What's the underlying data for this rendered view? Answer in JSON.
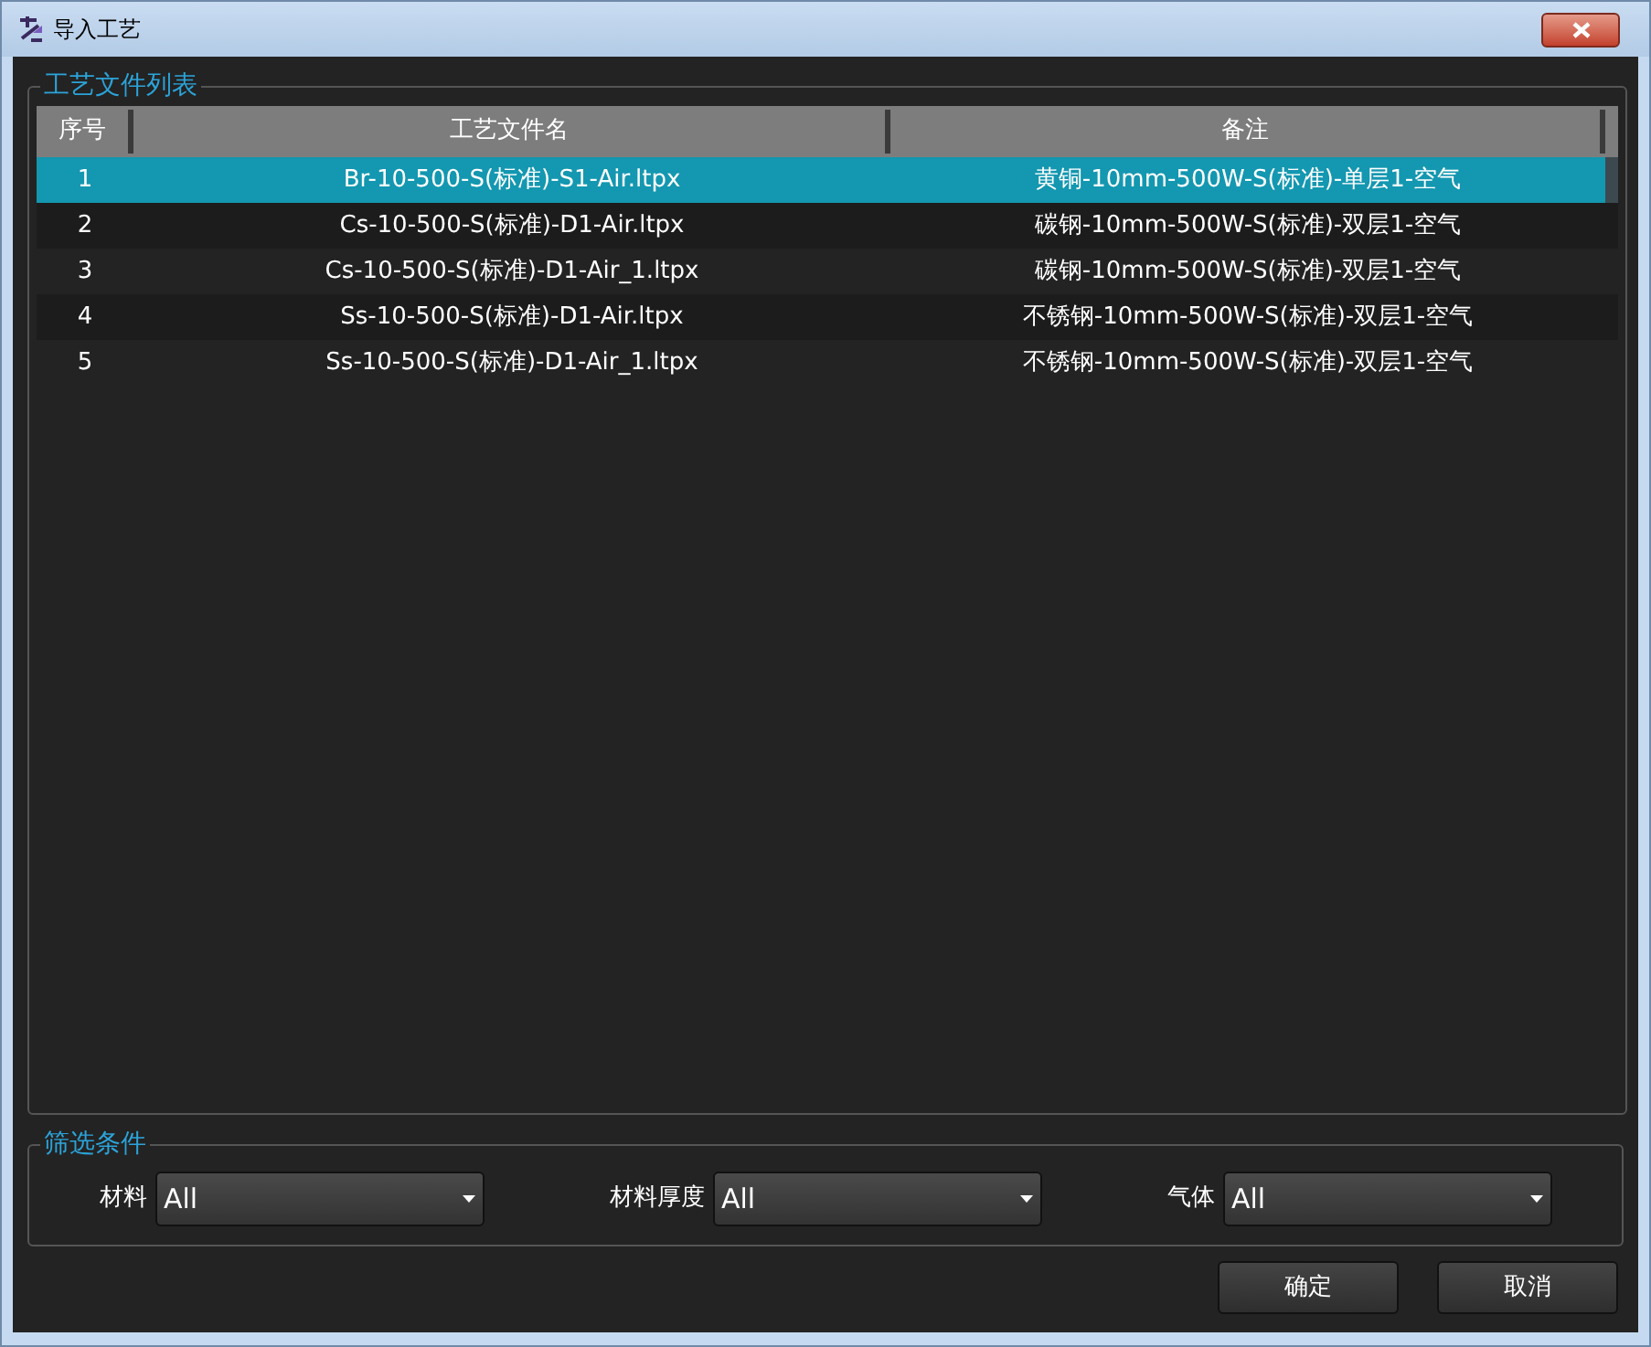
{
  "window": {
    "title": "导入工艺"
  },
  "list_group": {
    "title": "工艺文件列表"
  },
  "table": {
    "columns": [
      "序号",
      "工艺文件名",
      "备注"
    ],
    "rows": [
      {
        "cells": [
          "1",
          "Br-10-500-S(标准)-S1-Air.ltpx",
          "黄铜-10mm-500W-S(标准)-单层1-空气"
        ],
        "selected": true
      },
      {
        "cells": [
          "2",
          "Cs-10-500-S(标准)-D1-Air.ltpx",
          "碳钢-10mm-500W-S(标准)-双层1-空气"
        ],
        "selected": false
      },
      {
        "cells": [
          "3",
          "Cs-10-500-S(标准)-D1-Air_1.ltpx",
          "碳钢-10mm-500W-S(标准)-双层1-空气"
        ],
        "selected": false
      },
      {
        "cells": [
          "4",
          "Ss-10-500-S(标准)-D1-Air.ltpx",
          "不锈钢-10mm-500W-S(标准)-双层1-空气"
        ],
        "selected": false
      },
      {
        "cells": [
          "5",
          "Ss-10-500-S(标准)-D1-Air_1.ltpx",
          "不锈钢-10mm-500W-S(标准)-双层1-空气"
        ],
        "selected": false
      }
    ]
  },
  "filter_group": {
    "title": "筛选条件",
    "filters": [
      {
        "label": "材料",
        "value": "All"
      },
      {
        "label": "材料厚度",
        "value": "All"
      },
      {
        "label": "气体",
        "value": "All"
      }
    ]
  },
  "buttons": [
    "确定",
    "取消"
  ]
}
